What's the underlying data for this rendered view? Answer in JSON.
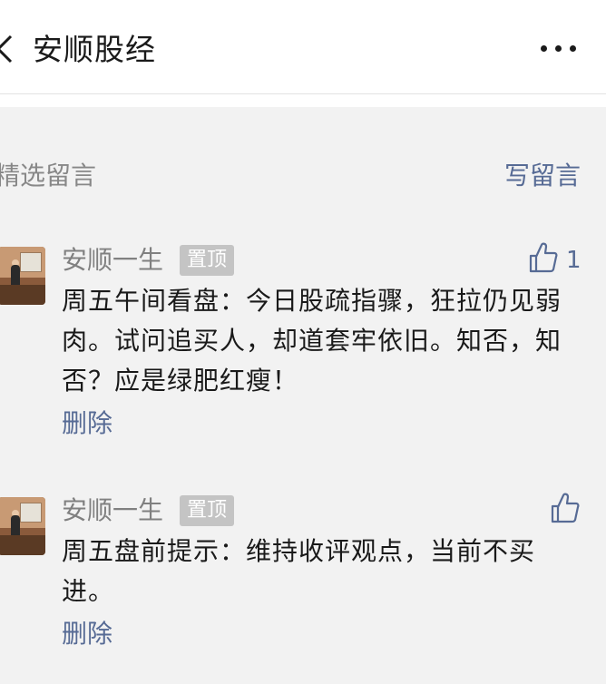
{
  "header": {
    "back_icon": "chevron-left-icon",
    "title": "安顺股经",
    "more_icon": "more-dots-icon"
  },
  "section": {
    "select_label": "精选留言",
    "write_label": "写留言"
  },
  "comments": [
    {
      "author": "安顺一生",
      "pin_label": "置顶",
      "likes": "1",
      "content": "周五午间看盘：今日股疏指骤，狂拉仍见弱肉。试问追买人，却道套牢依旧。知否，知否？应是绿肥红瘦！",
      "delete_label": "删除"
    },
    {
      "author": "安顺一生",
      "pin_label": "置顶",
      "likes": "",
      "content": "周五盘前提示：维持收评观点，当前不买进。",
      "delete_label": "删除"
    }
  ],
  "colors": {
    "link": "#576b95",
    "muted": "#808080",
    "pin_bg": "#c4c4c4",
    "page_bg": "#f2f2f2"
  }
}
